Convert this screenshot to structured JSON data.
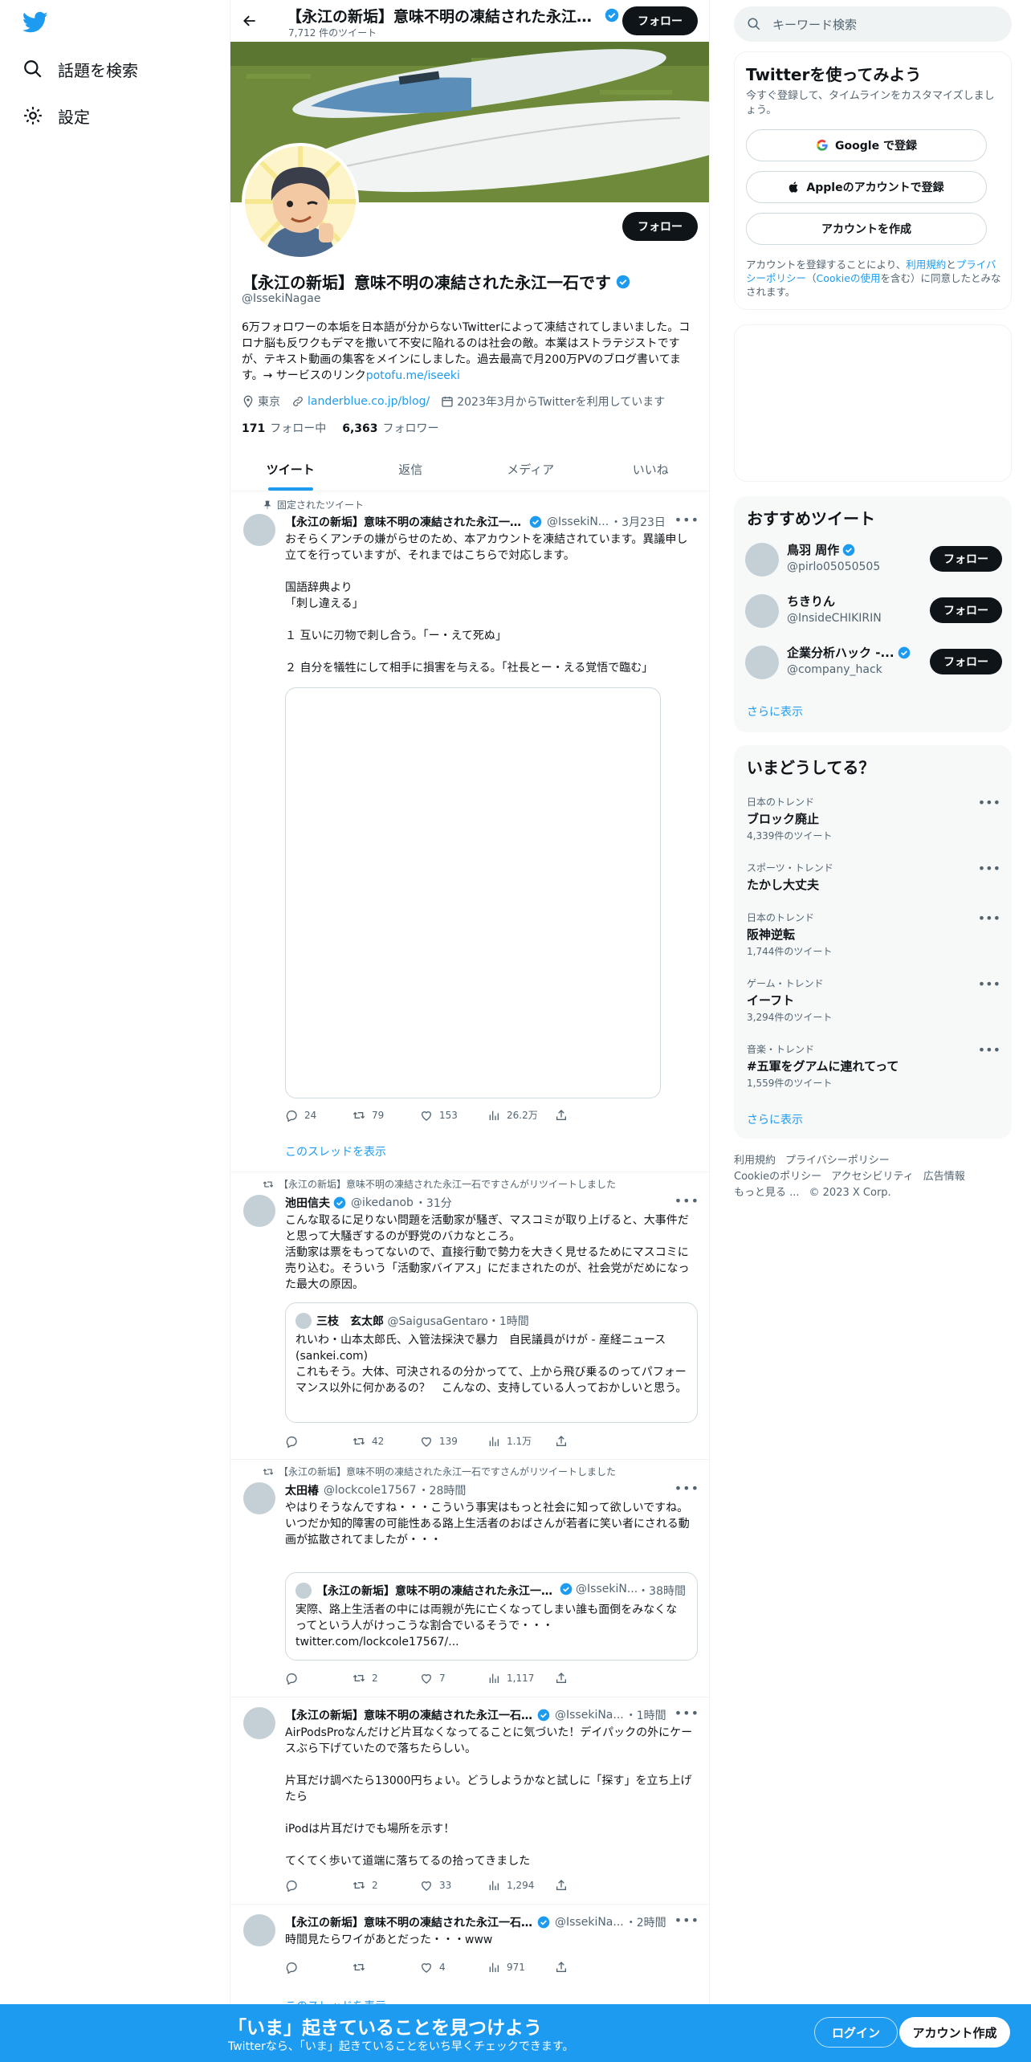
{
  "nav": {
    "explore_label": "話題を検索",
    "settings_label": "設定"
  },
  "header": {
    "title": "【永江の新垢】意味不明の凍結された永江一石です",
    "tweet_count": "7,712 件のツイート",
    "follow_label": "フォロー"
  },
  "profile": {
    "name": "【永江の新垢】意味不明の凍結された永江一石です",
    "handle": "@IssekiNagae",
    "follow_label": "フォロー",
    "bio_text": "6万フォロワーの本垢を日本語が分からないTwitterによって凍結されてしまいました。コロナ脳も反ワクもデマを撒いて不安に陥れるのは社会の敵。本業はストラテジストですが、テキスト動画の集客をメインにしました。過去最高で月200万PVのブログ書いてます。→ サービスのリンク",
    "bio_link": "potofu.me/iseeki",
    "location": "東京",
    "website": "landerblue.co.jp/blog/",
    "joined": "2023年3月からTwitterを利用しています",
    "following_count": "171",
    "following_label": "フォロー中",
    "followers_count": "6,363",
    "followers_label": "フォロワー"
  },
  "tabs": [
    "ツイート",
    "返信",
    "メディア",
    "いいね"
  ],
  "tweets": {
    "t1": {
      "pinned_label": "固定されたツイート",
      "name": "【永江の新垢】意味不明の凍結された永江一石です",
      "handle": "@IssekiN...",
      "time": "・3月23日",
      "text": "おそらくアンチの嫌がらせのため、本アカウントを凍結されています。異議申し立てを行っていますが、それまではこちらで対応します。\n\n国語辞典より\n「刺し違える」\n\n１ 互いに刃物で刺し合う。「ー・えて死ぬ」\n\n２ 自分を犠牲にして相手に損害を与える。「社長とー・える覚悟で臨む」",
      "reply": "24",
      "retweet": "79",
      "like": "153",
      "views": "26.2万",
      "thread_label": "このスレッドを表示"
    },
    "t2": {
      "rt_label": "【永江の新垢】意味不明の凍結された永江一石ですさんがリツイートしました",
      "name": "池田信夫",
      "handle": "@ikedanob",
      "time": "・31分",
      "text": "こんな取るに足りない問題を活動家が騒ぎ、マスコミが取り上げると、大事件だと思って大騒ぎするのが野党のバカなところ。\n活動家は票をもってないので、直接行動で勢力を大きく見せるためにマスコミに売り込む。そういう「活動家バイアス」にだまされたのが、社会党がだめになった最大の原因。",
      "quote_name": "三枝　玄太郎",
      "quote_handle": "@SaigusaGentaro",
      "quote_time": "・1時間",
      "quote_text": "れいわ・山本太郎氏、入管法採決で暴力　自民議員がけが - 産経ニュース (sankei.com)\nこれもそう。大体、可決されるの分かってて、上から飛び乗るのってパフォーマンス以外に何かあるの？　こんなの、支持している人っておかしいと思う。",
      "reply": "",
      "retweet": "42",
      "like": "139",
      "views": "1.1万"
    },
    "t3": {
      "rt_label": "【永江の新垢】意味不明の凍結された永江一石ですさんがリツイートしました",
      "name": "太田椿",
      "handle": "@lockcole17567",
      "time": "・28時間",
      "text": "やはりそうなんですね・・・こういう事実はもっと社会に知って欲しいですね。\nいつだか知的障害の可能性ある路上生活者のおばさんが若者に笑い者にされる動画が拡散されてましたが・・・",
      "quote_name": "【永江の新垢】意味不明の凍結された永江一石です",
      "quote_handle": "@IssekiN...",
      "quote_time": "・38時間",
      "quote_text": "実際、路上生活者の中には両親が先に亡くなってしまい誰も面倒をみなくなってという人がけっこうな割合でいるそうで・・・\ntwitter.com/lockcole17567/...",
      "reply": "",
      "retweet": "2",
      "like": "7",
      "views": "1,117"
    },
    "t4": {
      "name": "【永江の新垢】意味不明の凍結された永江一石です",
      "handle": "@IssekiNa...",
      "time": "・1時間",
      "text": "AirPodsProなんだけど片耳なくなってることに気づいた！デイパックの外にケースぶら下げていたので落ちたらしい。\n\n片耳だけ調べたら13000円ちょい。どうしようかなと試しに「探す」を立ち上げたら\n\niPodは片耳だけでも場所を示す！\n\nてくてく歩いて道端に落ちてるの拾ってきました",
      "reply": "",
      "retweet": "2",
      "like": "33",
      "views": "1,294"
    },
    "t5": {
      "name": "【永江の新垢】意味不明の凍結された永江一石です",
      "handle": "@IssekiNa...",
      "time": "・2時間",
      "text": "時間見たらワイがあとだった・・・www",
      "reply": "",
      "retweet": "",
      "like": "4",
      "views": "971",
      "thread_label": "このスレッドを表示"
    }
  },
  "sidebar": {
    "search_placeholder": "キーワード検索",
    "signup": {
      "title": "Twitterを使ってみよう",
      "desc": "今すぐ登録して、タイムラインをカスタマイズしましょう。",
      "google": "Google で登録",
      "apple": "Appleのアカウントで登録",
      "create": "アカウントを作成",
      "legal_pre": "アカウントを登録することにより、",
      "terms": "利用規約",
      "and": "と",
      "privacy": "プライバシーポリシー",
      "cookie_pre": "（",
      "cookie": "Cookieの使用",
      "legal_post": "を含む）に同意したとみなされます。"
    },
    "recommended": {
      "title": "おすすめツイート",
      "users": [
        {
          "name": "鳥羽 周作",
          "handle": "@pirlo05050505",
          "follow": "フォロー"
        },
        {
          "name": "ちきりん",
          "handle": "@InsideCHIKIRIN",
          "follow": "フォロー"
        },
        {
          "name": "企業分析ハック -...",
          "handle": "@company_hack",
          "follow": "フォロー"
        }
      ],
      "more": "さらに表示"
    },
    "trends": {
      "title": "いまどうしてる？",
      "items": [
        {
          "cat": "日本のトレンド",
          "topic": "ブロック廃止",
          "count": "4,339件のツイート"
        },
        {
          "cat": "スポーツ・トレンド",
          "topic": "たかし大丈夫",
          "count": ""
        },
        {
          "cat": "日本のトレンド",
          "topic": "阪神逆転",
          "count": "1,744件のツイート"
        },
        {
          "cat": "ゲーム・トレンド",
          "topic": "イーフト",
          "count": "3,294件のツイート"
        },
        {
          "cat": "音楽・トレンド",
          "topic": "#五軍をグアムに連れてって",
          "count": "1,559件のツイート"
        }
      ],
      "more": "さらに表示"
    },
    "footer": {
      "l1": "利用規約",
      "l2": "プライバシーポリシー",
      "l3": "Cookieのポリシー",
      "l4": "アクセシビリティ",
      "l5": "広告情報",
      "l6": "もっと見る ...",
      "copy": "© 2023 X Corp."
    }
  },
  "bottom": {
    "title": "「いま」起きていることを見つけよう",
    "subtitle": "Twitterなら、「いま」起きていることをいち早くチェックできます。",
    "login": "ログイン",
    "signup": "アカウント作成"
  },
  "colors": {
    "accent": "#1d9bf0",
    "dark": "#0f1419",
    "muted": "#536471"
  }
}
